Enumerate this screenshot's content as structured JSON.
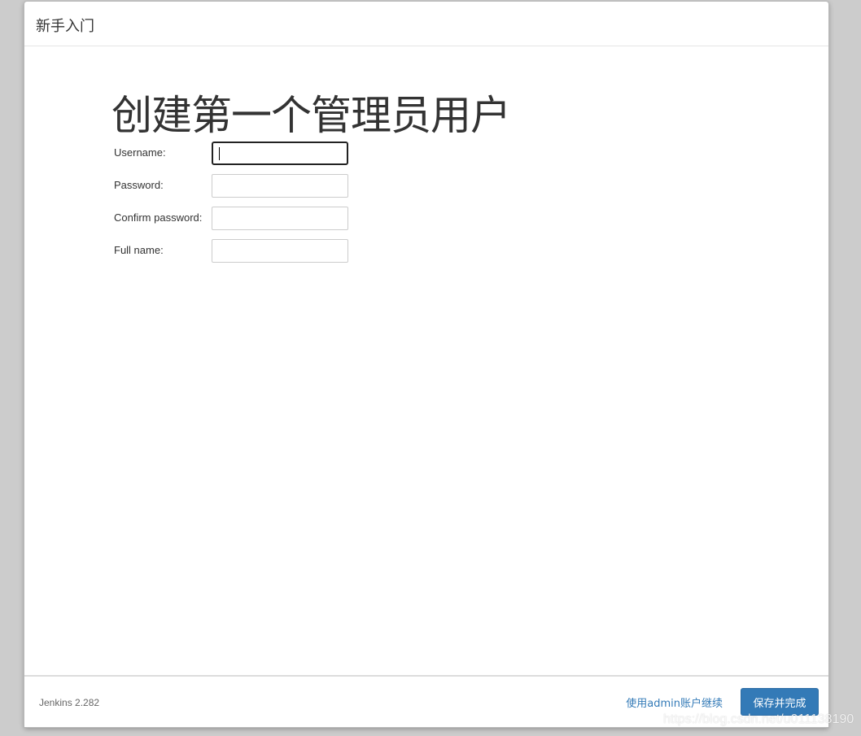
{
  "dialog": {
    "title": "新手入门",
    "heading": "创建第一个管理员用户"
  },
  "form": {
    "fields": [
      {
        "label": "Username:",
        "value": ""
      },
      {
        "label": "Password:",
        "value": ""
      },
      {
        "label": "Confirm password:",
        "value": ""
      },
      {
        "label": "Full name:",
        "value": ""
      }
    ]
  },
  "footer": {
    "version": "Jenkins 2.282",
    "continue_link": "使用admin账户继续",
    "save_button": "保存并完成"
  },
  "watermark": "https://blog.csdn.net/u011138190",
  "colors": {
    "accent": "#337ab7",
    "backdrop": "#cccccc"
  }
}
